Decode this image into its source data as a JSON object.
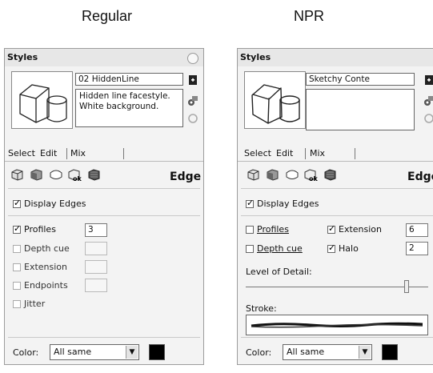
{
  "captions": {
    "left": "Regular",
    "right": "NPR"
  },
  "regular": {
    "title": "Styles",
    "style_name": "02 HiddenLine",
    "description": "Hidden line facestyle. White background.",
    "tabs": [
      "Select",
      "Edit",
      "Mix"
    ],
    "edge_label": "Edge",
    "display_edges": {
      "label": "Display Edges",
      "checked": true
    },
    "options": [
      {
        "label": "Profiles",
        "checked": true,
        "value": "3"
      },
      {
        "label": "Depth cue",
        "checked": false,
        "value": ""
      },
      {
        "label": "Extension",
        "checked": false,
        "value": ""
      },
      {
        "label": "Endpoints",
        "checked": false,
        "value": ""
      },
      {
        "label": "Jitter",
        "checked": false
      }
    ],
    "color_label": "Color:",
    "color_value": "All same",
    "color_swatch": "#000000"
  },
  "npr": {
    "title": "Styles",
    "style_name": "Sketchy Conte",
    "description": "",
    "tabs": [
      "Select",
      "Edit",
      "Mix"
    ],
    "edge_label": "Edge",
    "display_edges": {
      "label": "Display Edges",
      "checked": true
    },
    "profiles": {
      "label": "Profiles",
      "checked": false
    },
    "depth_cue": {
      "label": "Depth cue",
      "checked": false
    },
    "extension": {
      "label": "Extension",
      "checked": true,
      "value": "6"
    },
    "halo": {
      "label": "Halo",
      "checked": true,
      "value": "2"
    },
    "level_of_detail_label": "Level of Detail:",
    "level_of_detail_value": 0.88,
    "stroke_label": "Stroke:",
    "color_label": "Color:",
    "color_value": "All same",
    "color_swatch": "#000000"
  },
  "icons": {
    "edit_modes": [
      "edge-settings-icon",
      "face-settings-icon",
      "background-settings-icon",
      "watermark-settings-icon",
      "modeling-settings-icon"
    ],
    "side": [
      "create-style-icon",
      "update-style-icon",
      "refresh-icon"
    ]
  }
}
